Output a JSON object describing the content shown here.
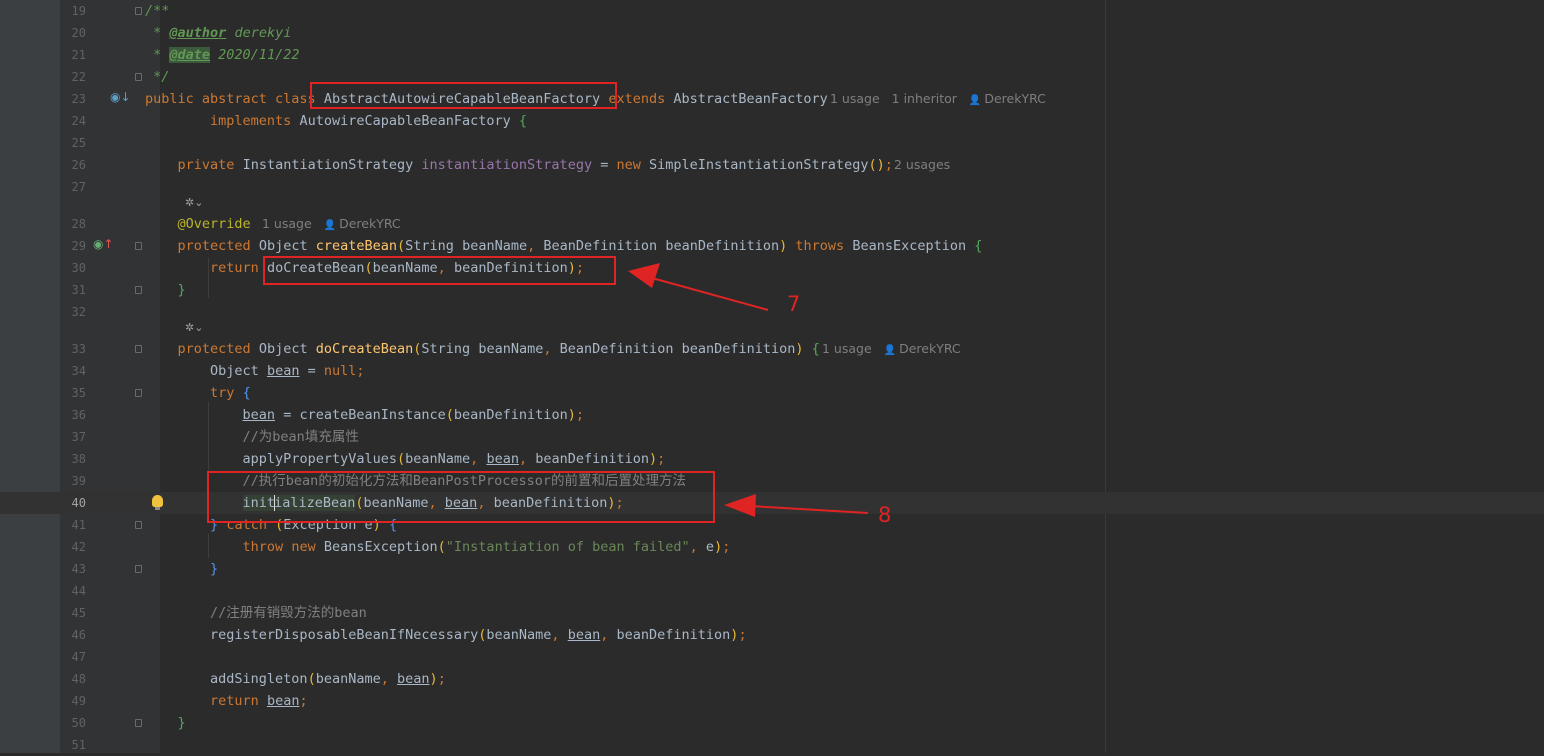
{
  "line_numbers": [
    "19",
    "20",
    "21",
    "22",
    "23",
    "24",
    "25",
    "26",
    "27",
    "28",
    "29",
    "30",
    "31",
    "32",
    "33",
    "34",
    "35",
    "36",
    "37",
    "38",
    "39",
    "40",
    "41",
    "42",
    "43",
    "44",
    "45",
    "46",
    "47",
    "48",
    "49",
    "50",
    "51"
  ],
  "code": {
    "doc_open": "/**",
    "author_tag": "@author",
    "author_name": "derekyi",
    "date_tag": "@date",
    "date_value": "2020/11/22",
    "doc_close": "*/",
    "class_decl_prefix": "public abstract class",
    "class_name": "AbstractAutowireCapableBeanFactory",
    "extends_kw": "extends",
    "super_class": "AbstractBeanFactory",
    "implements_kw": "implements",
    "interface_name": "AutowireCapableBeanFactory",
    "field_line_private": "private",
    "field_type": "InstantiationStrategy",
    "field_name": "instantiationStrategy",
    "field_new": "new",
    "field_ctor": "SimpleInstantiationStrategy",
    "override": "@Override",
    "protected": "protected",
    "object": "Object",
    "create_bean": "createBean",
    "string_type": "String",
    "bean_name": "beanName",
    "bean_definition_type": "BeanDefinition",
    "bean_definition": "beanDefinition",
    "throws_kw": "throws",
    "beans_exception": "BeansException",
    "return_kw": "return",
    "do_create_bean": "doCreateBean",
    "bean_var": "bean",
    "null_kw": "null",
    "try_kw": "try",
    "create_bean_instance": "createBeanInstance",
    "comment_fill": "//为bean填充属性",
    "apply_property_values": "applyPropertyValues",
    "comment_init": "//执行bean的初始化方法和BeanPostProcessor的前置和后置处理方法",
    "initialize_bean_a": "init",
    "initialize_bean_b": "ializeBean",
    "catch_kw": "catch",
    "exception_type": "Exception",
    "exception_var": "e",
    "throw_kw": "throw",
    "error_message": "\"Instantiation of bean failed\"",
    "comment_register": "//注册有销毁方法的bean",
    "register_disposable": "registerDisposableBeanIfNecessary",
    "add_singleton": "addSingleton"
  },
  "hints": {
    "class_usages": "1 usage",
    "class_inheritors": "1 inheritor",
    "class_author": "DerekYRC",
    "field_usages": "2 usages",
    "create_usages": "1 usage",
    "create_author": "DerekYRC",
    "do_create_usages": "1 usage",
    "do_create_author": "DerekYRC"
  },
  "annotations": {
    "callout_7": "7",
    "callout_8": "8"
  },
  "colors": {
    "background": "#2b2b2b",
    "keyword": "#cc7832",
    "method": "#ffc66d",
    "field": "#9876aa",
    "string": "#6a8759",
    "comment": "#808080",
    "annotation_red": "#e02424"
  },
  "icons": {
    "implemented": "implementation-gutter-icon",
    "override": "override-gutter-icon",
    "bulb": "lightbulb-icon",
    "lens": "code-vision-icon",
    "person": "person-icon"
  }
}
